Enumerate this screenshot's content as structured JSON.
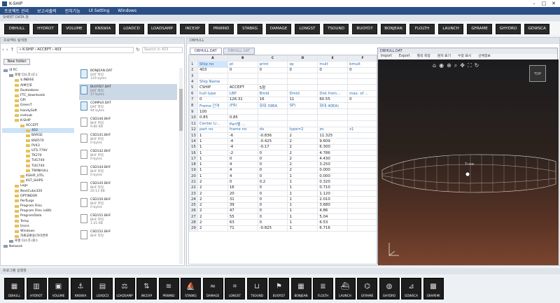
{
  "app": {
    "title": "K-SHIP"
  },
  "menu": [
    "프로젝트 관리",
    "보고서출력",
    "전처기능",
    "UI Setting",
    "Windows"
  ],
  "sheet_section_label": "SHEET DATA 창",
  "sheet_buttons": [
    "DBHULL",
    "HYDROT",
    "VOLUME",
    "KNSWIA",
    "LOADCD",
    "LOADSAMP",
    "INCEXP",
    "PRWIND",
    "STABKG",
    "DAMAGE",
    "LONGST",
    "TSOUND",
    "BUOYD7",
    "BONJEAN",
    "FLOLTH",
    "LAUNCH",
    "GFRAME",
    "GHYDRO",
    "GDWSCA"
  ],
  "explorer": {
    "title": "프로젝트 탐색창",
    "address": "« K-SHIP  ›  ACCEPT  ›  403",
    "search_placeholder": "Search in 403",
    "new_folder": "New folder",
    "tree": [
      {
        "label": "내 PC",
        "indent": 0,
        "type": "drive"
      },
      {
        "label": "로컬 디스크 (C:)",
        "indent": 1,
        "type": "drive"
      },
      {
        "label": "$.INBISE",
        "indent": 2,
        "type": "folder"
      },
      {
        "label": "AIM인포",
        "indent": 2,
        "type": "folder"
      },
      {
        "label": "Dualoxboss",
        "indent": 2,
        "type": "folder"
      },
      {
        "label": "FTC_downloads",
        "indent": 2,
        "type": "folder"
      },
      {
        "label": "GPI",
        "indent": 2,
        "type": "folder"
      },
      {
        "label": "GreenT",
        "indent": 2,
        "type": "folder"
      },
      {
        "label": "HandySoft",
        "indent": 2,
        "type": "folder"
      },
      {
        "label": "inetsub",
        "indent": 2,
        "type": "folder"
      },
      {
        "label": "K-SHIP",
        "indent": 2,
        "type": "folder"
      },
      {
        "label": "ACCEPT",
        "indent": 3,
        "type": "folder"
      },
      {
        "label": "403",
        "indent": 4,
        "type": "folder",
        "selected": true
      },
      {
        "label": "BARGE",
        "indent": 4,
        "type": "folder"
      },
      {
        "label": "BS6570",
        "indent": 4,
        "type": "folder"
      },
      {
        "label": "PV43",
        "indent": 4,
        "type": "folder"
      },
      {
        "label": "UTS-779V",
        "indent": 4,
        "type": "folder"
      },
      {
        "label": "TK270",
        "indent": 4,
        "type": "folder"
      },
      {
        "label": "TUG740",
        "indent": 4,
        "type": "folder"
      },
      {
        "label": "TUG740",
        "indent": 4,
        "type": "folder"
      },
      {
        "label": "TWINHULL",
        "indent": 4,
        "type": "folder"
      },
      {
        "label": "KSHIP_UTIL",
        "indent": 3,
        "type": "folder"
      },
      {
        "label": "KST_SHIPS",
        "indent": 3,
        "type": "folder"
      },
      {
        "label": "Logs",
        "indent": 2,
        "type": "folder"
      },
      {
        "label": "NextCube320",
        "indent": 2,
        "type": "folder"
      },
      {
        "label": "OPTINDOR",
        "indent": 2,
        "type": "folder"
      },
      {
        "label": "PerfLogs",
        "indent": 2,
        "type": "folder"
      },
      {
        "label": "Program Files",
        "indent": 2,
        "type": "folder"
      },
      {
        "label": "Program Files (x86)",
        "indent": 2,
        "type": "folder"
      },
      {
        "label": "ProgramData",
        "indent": 2,
        "type": "folder"
      },
      {
        "label": "Temp",
        "indent": 2,
        "type": "folder"
      },
      {
        "label": "Users",
        "indent": 2,
        "type": "folder"
      },
      {
        "label": "Windows",
        "indent": 2,
        "type": "folder"
      },
      {
        "label": "자료교환용(하이컨트",
        "indent": 2,
        "type": "folder"
      },
      {
        "label": "로컬 디스크 (D:)",
        "indent": 1,
        "type": "drive"
      },
      {
        "label": "Network",
        "indent": 0,
        "type": "drive"
      }
    ],
    "files": [
      {
        "name": "BONJEAN.DAT",
        "type": "DAT 파일",
        "size": "129 bytes",
        "kind": "dat",
        "selected": false
      },
      {
        "name": "BUOYD7.DAT",
        "type": "DAT 파일",
        "size": "27 bytes",
        "kind": "dat",
        "selected": true
      },
      {
        "name": "COMPLR.DAT",
        "type": "DAT 파일",
        "size": "94 bytes",
        "kind": "dat",
        "selected": false
      },
      {
        "name": "CSD140.BHF",
        "type": "BHF 파일",
        "size": "9.80 KB",
        "kind": "doc",
        "selected": false
      },
      {
        "name": "CSD141.BHF",
        "type": "BHF 파일",
        "size": "0 bytes",
        "kind": "doc",
        "selected": false
      },
      {
        "name": "CSD142.BHF",
        "type": "BHF 파일",
        "size": "0 bytes",
        "kind": "doc",
        "selected": false
      },
      {
        "name": "CSD144.BHF",
        "type": "BHF 파일",
        "size": "0 bytes",
        "kind": "doc",
        "selected": false
      },
      {
        "name": "CSD145.BHF",
        "type": "BHF 파일",
        "size": "20.12 KB",
        "kind": "doc",
        "selected": false
      },
      {
        "name": "CSD150.BHF",
        "type": "BHF 파일",
        "size": "0 bytes",
        "kind": "doc",
        "selected": false
      },
      {
        "name": "CSD151.BHF",
        "type": "BHF 파일",
        "size": "1.25 KB",
        "kind": "doc",
        "selected": false
      },
      {
        "name": "CSD152.BHF",
        "type": "BHF 파일",
        "size": "",
        "kind": "doc",
        "selected": false
      }
    ]
  },
  "main": {
    "title": "DBHULL",
    "tabs": [
      "DBHULL.DAT",
      "DBHULL.SAT"
    ],
    "col_headers": [
      "A",
      "B",
      "C",
      "D",
      "E",
      "F"
    ],
    "rows": [
      {
        "n": "1",
        "cells": [
          "Ship no",
          "pt",
          "print",
          "sp",
          "mult",
          "bmult"
        ],
        "style": "hdr"
      },
      {
        "n": "2",
        "cells": [
          "403",
          "0",
          "0",
          "0",
          "0",
          "0"
        ]
      },
      {
        "n": "3",
        "cells": [
          "",
          "",
          "",
          "",
          "",
          ""
        ]
      },
      {
        "n": "4",
        "cells": [
          "Ship Name",
          "",
          "",
          "",
          "",
          ""
        ],
        "style": "hdr"
      },
      {
        "n": "5",
        "cells": [
          "CSHIP",
          "ACCEPT",
          "5청",
          "",
          "",
          ""
        ]
      },
      {
        "n": "6",
        "cells": [
          "hull type",
          "LBP",
          "Bmld",
          "Dmld",
          "Dist from...",
          "max. of ..."
        ],
        "style": "hdr"
      },
      {
        "n": "7",
        "cells": [
          "0",
          "126.31",
          "16",
          "11",
          "60.55",
          "0"
        ]
      },
      {
        "n": "8",
        "cells": [
          "Frame 간격",
          "(FR/",
          "화대 39EA",
          "SP)",
          "화대 40EA)",
          ""
        ],
        "style": "hdr"
      },
      {
        "n": "9",
        "cells": [
          "100",
          "",
          "",
          "",
          "",
          ""
        ]
      },
      {
        "n": "10",
        "cells": [
          "0.85",
          "0.85",
          "",
          "",
          "",
          ""
        ]
      },
      {
        "n": "11",
        "cells": [
          "Center Li...",
          "Part별 ...",
          "",
          "",
          "",
          ""
        ],
        "style": "hdr"
      },
      {
        "n": "12",
        "cells": [
          "part no",
          "frame no",
          "dx",
          "type=2",
          "zo",
          "z1"
        ],
        "style": "hdr"
      },
      {
        "n": "13",
        "cells": [
          "1",
          "-6",
          "-0.836",
          "2",
          "11.325",
          ""
        ]
      },
      {
        "n": "14",
        "cells": [
          "1",
          "-4",
          "-0.425",
          "2",
          "9.609",
          ""
        ]
      },
      {
        "n": "15",
        "cells": [
          "1",
          "-4",
          "-0.17",
          "2",
          "6.300",
          ""
        ]
      },
      {
        "n": "16",
        "cells": [
          "1",
          "-2",
          "0",
          "2",
          "4.786",
          ""
        ]
      },
      {
        "n": "17",
        "cells": [
          "1",
          "0",
          "0",
          "2",
          "4.430",
          ""
        ]
      },
      {
        "n": "18",
        "cells": [
          "1",
          "4",
          "0",
          "2",
          "3.250",
          ""
        ]
      },
      {
        "n": "19",
        "cells": [
          "1",
          "4",
          "0",
          "2",
          "0.000",
          ""
        ]
      },
      {
        "n": "20",
        "cells": [
          "1",
          "4",
          "0",
          "1",
          "0.000",
          ""
        ]
      },
      {
        "n": "21",
        "cells": [
          "2",
          "0",
          "0.2",
          "1",
          "0.320",
          ""
        ]
      },
      {
        "n": "22",
        "cells": [
          "2",
          "16",
          "0",
          "1",
          "0.710",
          ""
        ]
      },
      {
        "n": "23",
        "cells": [
          "2",
          "20",
          "0",
          "1",
          "1.120",
          ""
        ]
      },
      {
        "n": "24",
        "cells": [
          "2",
          "31",
          "0",
          "1",
          "2.010",
          ""
        ]
      },
      {
        "n": "25",
        "cells": [
          "2",
          "39",
          "0",
          "1",
          "3.680",
          ""
        ]
      },
      {
        "n": "26",
        "cells": [
          "2",
          "47",
          "0",
          "1",
          "4.86",
          ""
        ]
      },
      {
        "n": "27",
        "cells": [
          "2",
          "55",
          "0",
          "1",
          "5.04",
          ""
        ]
      },
      {
        "n": "28",
        "cells": [
          "2",
          "63",
          "0",
          "1",
          "6.53",
          ""
        ]
      },
      {
        "n": "29",
        "cells": [
          "2",
          "71",
          "-0.825",
          "1",
          "6.716",
          ""
        ]
      }
    ]
  },
  "viewer": {
    "title": "DBHULL.DAT",
    "menu": [
      "Import",
      "Export",
      "절곡 측정",
      "문자 표기",
      "수정 표시",
      "선체정보"
    ],
    "navcube": "TOP",
    "model_label": "Ti mls"
  },
  "bottom_section_label": "프로그램 실행창",
  "program_buttons": [
    {
      "label": "DBHULL",
      "icon": "▦"
    },
    {
      "label": "HYDROT",
      "icon": "▥"
    },
    {
      "label": "VOLUME",
      "icon": "▣"
    },
    {
      "label": "KNSWIA",
      "icon": "⚓"
    },
    {
      "label": "LOADCD",
      "icon": "▤"
    },
    {
      "label": "LOADSAMP",
      "icon": "⚖"
    },
    {
      "label": "INCEXP",
      "icon": "⇅"
    },
    {
      "label": "PRWIND",
      "icon": "≋"
    },
    {
      "label": "STABKG",
      "icon": "⛵"
    },
    {
      "label": "DAMAGE",
      "icon": "≈"
    },
    {
      "label": "LONGST",
      "icon": "⌗"
    },
    {
      "label": "TSOUND",
      "icon": "⊔"
    },
    {
      "label": "BUOYD7",
      "icon": "⚑"
    },
    {
      "label": "BONJEAN",
      "icon": "▦"
    },
    {
      "label": "FLOLTH",
      "icon": "≣"
    },
    {
      "label": "LAUNCH",
      "icon": "⛴"
    },
    {
      "label": "GFRAME",
      "icon": "⌬"
    },
    {
      "label": "GHYDRO",
      "icon": "◍"
    },
    {
      "label": "GDWSCA",
      "icon": "⊿"
    },
    {
      "label": "GRAPEMI",
      "icon": "▩"
    }
  ]
}
